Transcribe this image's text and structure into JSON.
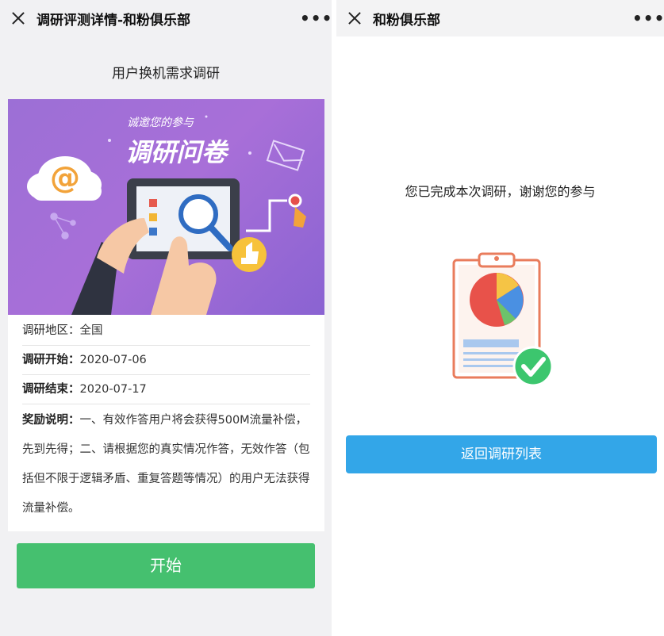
{
  "left": {
    "nav": {
      "title": "调研评测详情-和粉俱乐部",
      "more": "•••"
    },
    "survey_title": "用户换机需求调研",
    "banner": {
      "subtitle": "诚邀您的参与",
      "title": "调研问卷",
      "at_symbol": "@"
    },
    "info": {
      "region_label": "调研地区：",
      "region_value": "全国",
      "start_label": "调研开始：",
      "start_value": "2020-07-06",
      "end_label": "调研结束：",
      "end_value": "2020-07-17",
      "reward_label": "奖励说明：",
      "reward_value": "一、有效作答用户将会获得500M流量补偿，先到先得；二、请根据您的真实情况作答，无效作答（包括但不限于逻辑矛盾、重复答题等情况）的用户无法获得流量补偿。"
    },
    "start_button": "开始"
  },
  "right": {
    "nav": {
      "title": "和粉俱乐部",
      "more": "•••"
    },
    "done_text": "您已完成本次调研，谢谢您的参与",
    "back_button": "返回调研列表"
  },
  "colors": {
    "banner_purple": "#9c6fd6",
    "start_green": "#45c06f",
    "back_blue": "#33a6e8",
    "check_green": "#3cc66e"
  }
}
